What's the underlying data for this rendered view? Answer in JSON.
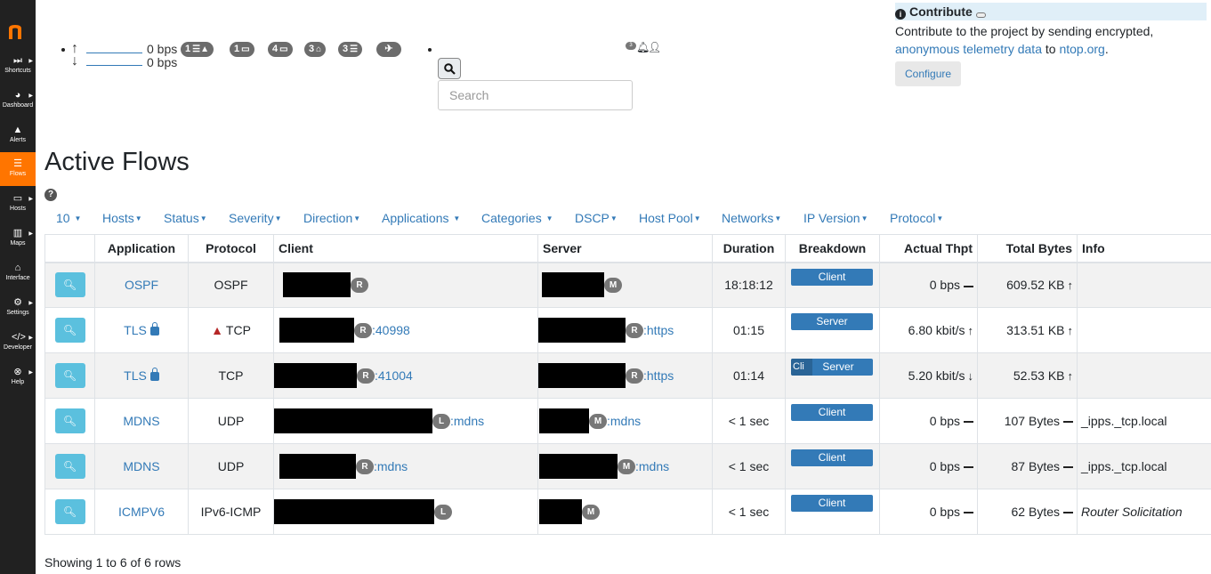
{
  "sidebar": {
    "items": [
      {
        "label": "Shortcuts",
        "icon": "fast-forward-icon"
      },
      {
        "label": "Dashboard",
        "icon": "dashboard-icon"
      },
      {
        "label": "Alerts",
        "icon": "warning-icon"
      },
      {
        "label": "Flows",
        "icon": "list-icon"
      },
      {
        "label": "Hosts",
        "icon": "laptop-icon"
      },
      {
        "label": "Maps",
        "icon": "map-icon"
      },
      {
        "label": "Interface",
        "icon": "interface-icon"
      },
      {
        "label": "Settings",
        "icon": "gear-icon"
      },
      {
        "label": "Developer",
        "icon": "code-icon"
      },
      {
        "label": "Help",
        "icon": "life-ring-icon"
      }
    ]
  },
  "topbar": {
    "upload_bps": "0 bps",
    "download_bps": "0 bps",
    "badges": [
      "1",
      "1",
      "4",
      "3",
      "3"
    ],
    "search_placeholder": "Search",
    "notification_count": "3"
  },
  "contribute": {
    "title": "Contribute",
    "text_before": "Contribute to the project by sending encrypted,",
    "link1": "anonymous telemetry data",
    "text_mid": " to ",
    "link2": "ntop.org",
    "text_end": ".",
    "button": "Configure"
  },
  "page_title": "Active Flows",
  "filters": [
    "10",
    "Hosts",
    "Status",
    "Severity",
    "Direction",
    "Applications ",
    "Categories ",
    "DSCP",
    "Host Pool",
    "Networks",
    "IP Version",
    "Protocol"
  ],
  "table": {
    "headers": [
      "",
      "Application",
      "Protocol",
      "Client",
      "Server",
      "Duration",
      "Breakdown",
      "Actual Thpt",
      "Total Bytes",
      "Info"
    ],
    "rows": [
      {
        "app": "OSPF",
        "protocol": "OSPF",
        "client_tag": "R",
        "client_port": "",
        "server_tag": "M",
        "server_port": "",
        "duration": "18:18:12",
        "breakdown": "Client",
        "thpt": "0 bps",
        "bytes": "609.52 KB",
        "info": ""
      },
      {
        "app": "TLS",
        "protocol": "TCP",
        "client_tag": "R",
        "client_port": ":40998",
        "server_tag": "R",
        "server_port": ":https",
        "duration": "01:15",
        "breakdown": "Server",
        "thpt": "6.80 kbit/s",
        "bytes": "313.51 KB",
        "info": ""
      },
      {
        "app": "TLS",
        "protocol": "TCP",
        "client_tag": "R",
        "client_port": ":41004",
        "server_tag": "R",
        "server_port": ":https",
        "duration": "01:14",
        "breakdown_cli": "Cli",
        "breakdown": "Server",
        "thpt": "5.20 kbit/s",
        "bytes": "52.53 KB",
        "info": ""
      },
      {
        "app": "MDNS",
        "protocol": "UDP",
        "client_tag": "L",
        "client_port": ":mdns",
        "server_tag": "M",
        "server_port": ":mdns",
        "duration": "< 1 sec",
        "breakdown": "Client",
        "thpt": "0 bps",
        "bytes": "107 Bytes",
        "info": "_ipps._tcp.local"
      },
      {
        "app": "MDNS",
        "protocol": "UDP",
        "client_tag": "R",
        "client_port": ":mdns",
        "server_tag": "M",
        "server_port": ":mdns",
        "duration": "< 1 sec",
        "breakdown": "Client",
        "thpt": "0 bps",
        "bytes": "87 Bytes",
        "info": "_ipps._tcp.local"
      },
      {
        "app": "ICMPV6",
        "protocol": "IPv6-ICMP",
        "client_tag": "L",
        "client_port": "",
        "server_tag": "M",
        "server_port": "",
        "duration": "< 1 sec",
        "breakdown": "Client",
        "thpt": "0 bps",
        "bytes": "62 Bytes",
        "info": "Router Solicitation"
      }
    ]
  },
  "footer": "Showing 1 to 6 of 6 rows",
  "colors": {
    "sidebar": "#212121",
    "active": "#ff7500",
    "link": "#337ab7",
    "zoom": "#5bc0de"
  }
}
